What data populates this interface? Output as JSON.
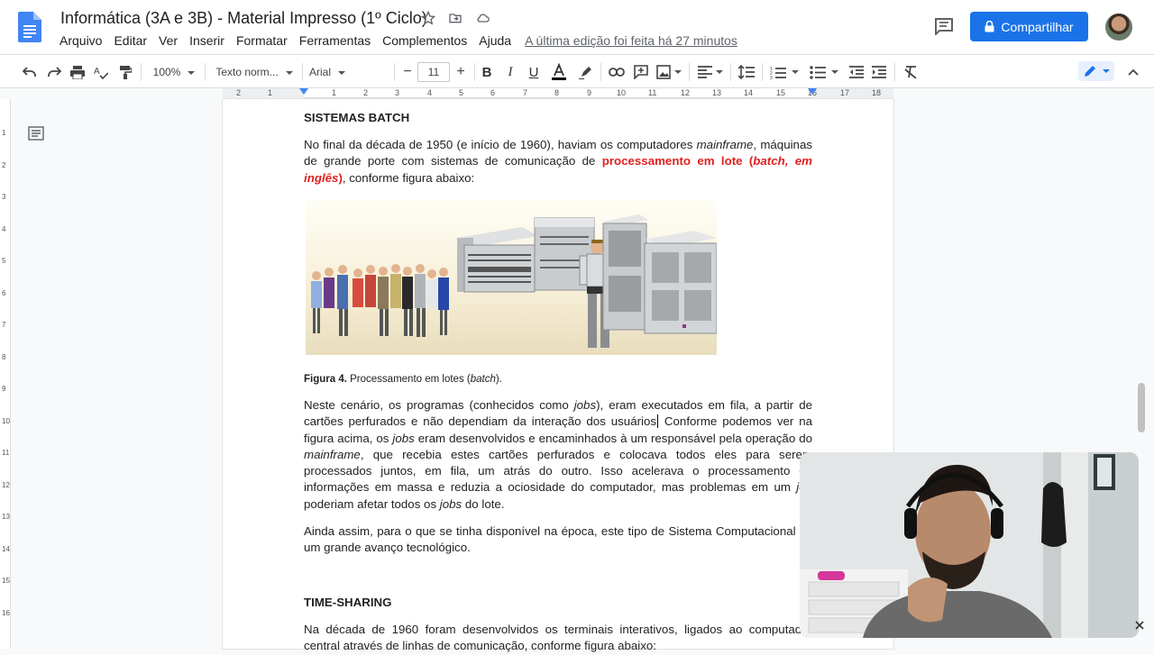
{
  "header": {
    "title": "Informática (3A e 3B) - Material Impresso (1º Ciclo)",
    "menu": [
      "Arquivo",
      "Editar",
      "Ver",
      "Inserir",
      "Formatar",
      "Ferramentas",
      "Complementos",
      "Ajuda"
    ],
    "last_edit": "A última edição foi feita há 27 minutos",
    "share_label": "Compartilhar"
  },
  "toolbar": {
    "zoom": "100%",
    "style": "Texto norm...",
    "font": "Arial",
    "font_size": "11",
    "text_color": "#000000"
  },
  "ruler": {
    "ticks": [
      "2",
      "1",
      "1",
      "2",
      "3",
      "4",
      "5",
      "6",
      "7",
      "8",
      "9",
      "10",
      "11",
      "12",
      "13",
      "14",
      "15",
      "16",
      "17",
      "18"
    ]
  },
  "vruler": {
    "ticks": [
      "1",
      "2",
      "3",
      "4",
      "5",
      "6",
      "7",
      "8",
      "9",
      "10",
      "11",
      "12",
      "13",
      "14",
      "15",
      "16"
    ]
  },
  "doc": {
    "h1": "SISTEMAS BATCH",
    "p1_a": "No final da década de 1950 (e início de 1960), haviam os computadores ",
    "p1_b": "mainframe",
    "p1_c": ", máquinas de grande porte com sistemas de comunicação de ",
    "p1_red_a": "processamento em lote (",
    "p1_red_b": "batch, em inglês",
    "p1_red_c": ")",
    "p1_d": ", conforme figura abaixo:",
    "caption_bold": "Figura 4.",
    "caption_a": " Processamento em lotes (",
    "caption_b": "batch",
    "caption_c": ").",
    "p2_a": "Neste cenário, os programas (conhecidos como ",
    "p2_b": "jobs",
    "p2_c": "), eram executados em fila, a partir de cartões perfurados e não dependiam da interação dos usuários",
    "p2_d": " Conforme podemos ver na figura acima, os ",
    "p2_e": "jobs",
    "p2_f": " eram desenvolvidos e encaminhados à um responsável pela operação do ",
    "p2_g": "mainframe",
    "p2_h": ", que recebia estes cartões perfurados e colocava todos eles para serem processados juntos, em fila, um atrás do outro. Isso acelerava o processamento de informações em massa e reduzia a ociosidade do computador, mas problemas em um ",
    "p2_i": "job",
    "p2_j": " poderiam afetar todos os ",
    "p2_k": "jobs",
    "p2_l": " do lote.",
    "p3": "Ainda assim, para o que se tinha disponível na época, este tipo de Sistema Computacional foi um grande avanço tecnológico.",
    "h2": "TIME-SHARING",
    "p4": "Na década de 1960 foram desenvolvidos os terminais interativos, ligados ao computador central através de linhas de comunicação, conforme figura abaixo:"
  },
  "colors": {
    "accent": "#1a73e8",
    "highlight_red": "#e02020"
  }
}
